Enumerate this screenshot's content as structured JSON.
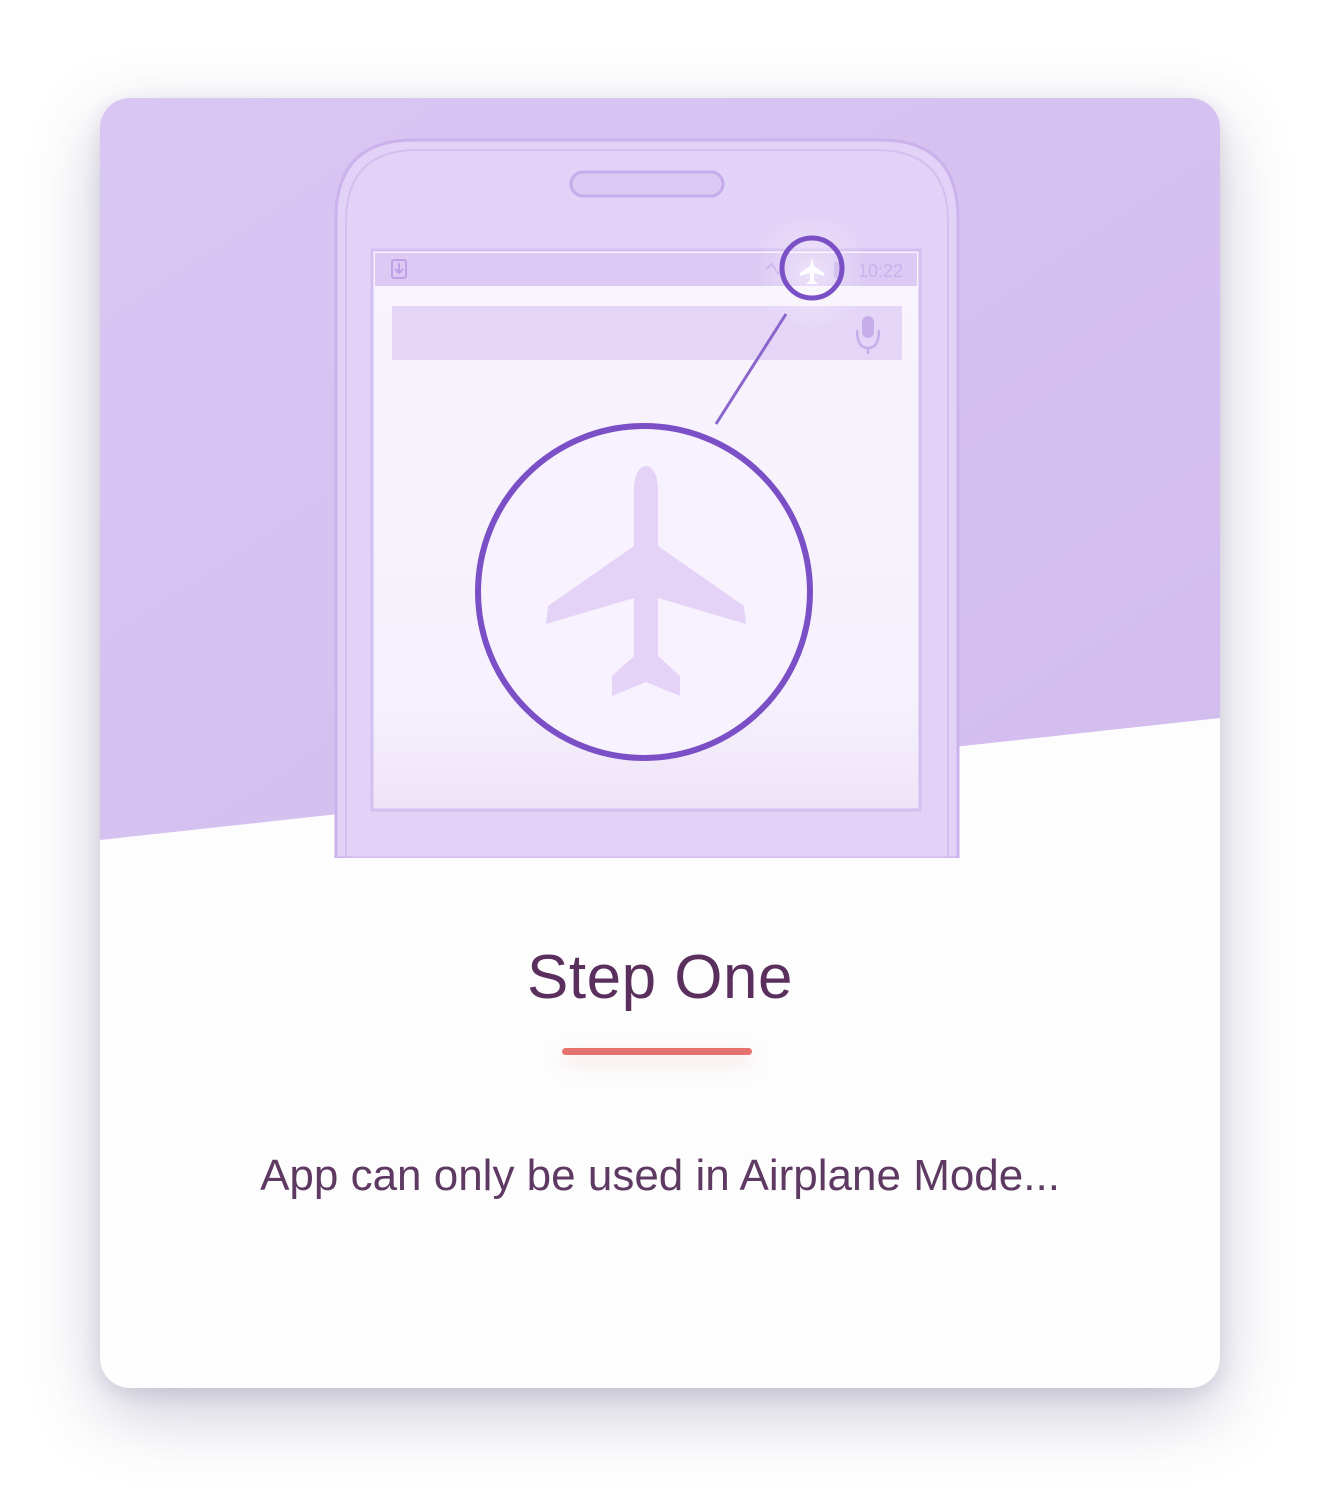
{
  "card": {
    "title": "Step One",
    "description": "App can only be used in Airplane Mode..."
  },
  "illustration": {
    "status_time": "10:22",
    "icons": [
      "download-icon",
      "vibrate-icon",
      "airplane-icon",
      "battery-icon",
      "microphone-icon",
      "airplane-icon"
    ]
  },
  "colors": {
    "hero_bg": "#d6c3f1",
    "phone_fill": "#e4d3f7",
    "highlight_ring": "#7b4fc5",
    "title_text": "#5a2f5e",
    "accent_underline": "#e5726c",
    "body_text": "#5e3a62"
  }
}
